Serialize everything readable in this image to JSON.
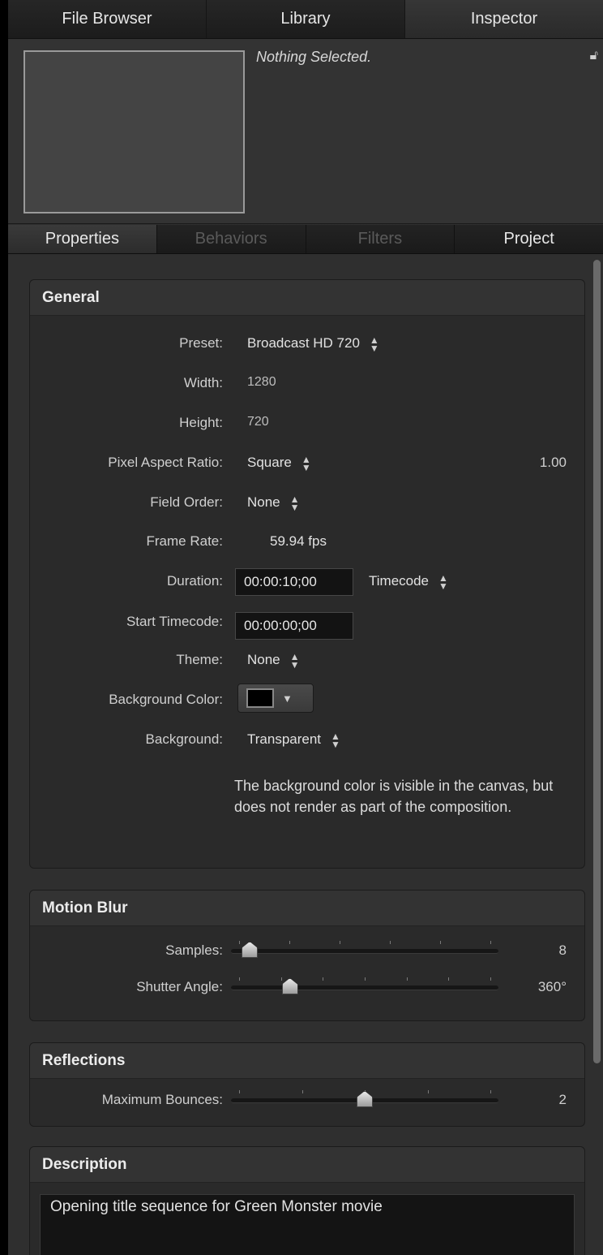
{
  "top_tabs": [
    "File Browser",
    "Library",
    "Inspector"
  ],
  "preview": {
    "status": "Nothing Selected."
  },
  "sub_tabs": [
    "Properties",
    "Behaviors",
    "Filters",
    "Project"
  ],
  "general": {
    "title": "General",
    "preset_label": "Preset:",
    "preset_value": "Broadcast HD 720",
    "width_label": "Width:",
    "width_value": "1280",
    "height_label": "Height:",
    "height_value": "720",
    "par_label": "Pixel Aspect Ratio:",
    "par_value": "Square",
    "par_ratio": "1.00",
    "field_order_label": "Field Order:",
    "field_order_value": "None",
    "frame_rate_label": "Frame Rate:",
    "frame_rate_value": "59.94  fps",
    "duration_label": "Duration:",
    "duration_value": "00:00:10;00",
    "duration_format": "Timecode",
    "start_tc_label": "Start Timecode:",
    "start_tc_value": "00:00:00;00",
    "theme_label": "Theme:",
    "theme_value": "None",
    "bg_color_label": "Background Color:",
    "bg_color": "#000000",
    "background_label": "Background:",
    "background_value": "Transparent",
    "note": "The background color is visible in the canvas, but does not render as part of the composition."
  },
  "motion_blur": {
    "title": "Motion Blur",
    "samples_label": "Samples:",
    "samples_value": "8",
    "samples_level": 0.07,
    "shutter_label": "Shutter Angle:",
    "shutter_value": "360°",
    "shutter_level": 0.22
  },
  "reflections": {
    "title": "Reflections",
    "bounces_label": "Maximum Bounces:",
    "bounces_value": "2",
    "bounces_level": 0.5
  },
  "description": {
    "title": "Description",
    "text": "Opening title sequence for Green Monster movie"
  }
}
